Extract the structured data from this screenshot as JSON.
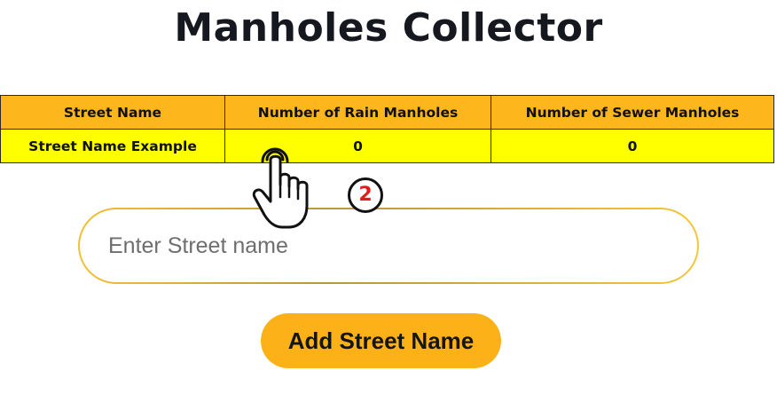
{
  "page": {
    "title": "Manholes Collector"
  },
  "table": {
    "headers": [
      "Street Name",
      "Number of Rain Manholes",
      "Number of Sewer Manholes"
    ],
    "rows": [
      [
        "Street Name Example",
        "0",
        "0"
      ]
    ]
  },
  "search": {
    "placeholder": "Enter Street name",
    "value": ""
  },
  "add_button": {
    "label": "Add Street Name"
  },
  "overlay": {
    "hand_icon": "pointing-hand-icon",
    "step_number": "2"
  },
  "colors": {
    "header_bg": "#fdb61c",
    "row_bg": "#ffff00",
    "button_bg": "#fbb117",
    "badge_number": "#e31b1b"
  }
}
